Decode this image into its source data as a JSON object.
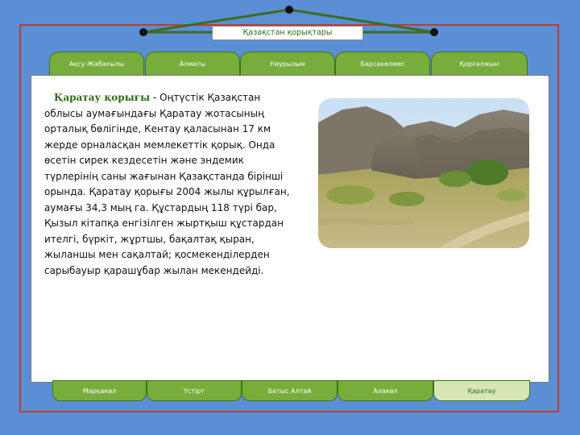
{
  "slide": {
    "title": "Қазақстан қорықтары"
  },
  "top_tabs": [
    {
      "label": "Ақсу-Жабағылы"
    },
    {
      "label": "Алматы"
    },
    {
      "label": "Наурызым"
    },
    {
      "label": "Барсакелмес"
    },
    {
      "label": "Қорғалжын"
    }
  ],
  "bottom_tabs": [
    {
      "label": "Марқакөл"
    },
    {
      "label": "Үстірт"
    },
    {
      "label": "Батыс Алтай"
    },
    {
      "label": "Алакөл"
    },
    {
      "label": "Қаратау",
      "active": true
    }
  ],
  "article": {
    "heading": "Қаратау қорығы",
    "body": " - Оңтүстік Қазақстан облысы аумағындағы Қаратау жотасының орталық бөлігінде, Кентау қаласынан 17 км жерде орналасқан мемлекеттік қорық. Онда өсетін сирек кездесетін және эндемик түрлерінің саны жағынан Қазақстанда бірінші орында. Қаратау қорығы 2004 жылы құрылған, аумағы 34,3 мың га. Құстардың 118 түрі бар, Қызыл кітапқа енгізілген жыртқыш құстардан ителгі, бүркіт, жұртшы, бақалтақ қыран, жыланшы мен сақалтай; қосмекенділерден сарыбауыр қарашұбар жылан мекендейді."
  },
  "colors": {
    "background": "#5a8fd6",
    "tab_green": "#78ad3c",
    "tab_active": "#d8e6b6",
    "frame_red": "#c0392b",
    "heading_green": "#2f6a16"
  },
  "icons": {
    "photo": "mountain-landscape-photo"
  }
}
